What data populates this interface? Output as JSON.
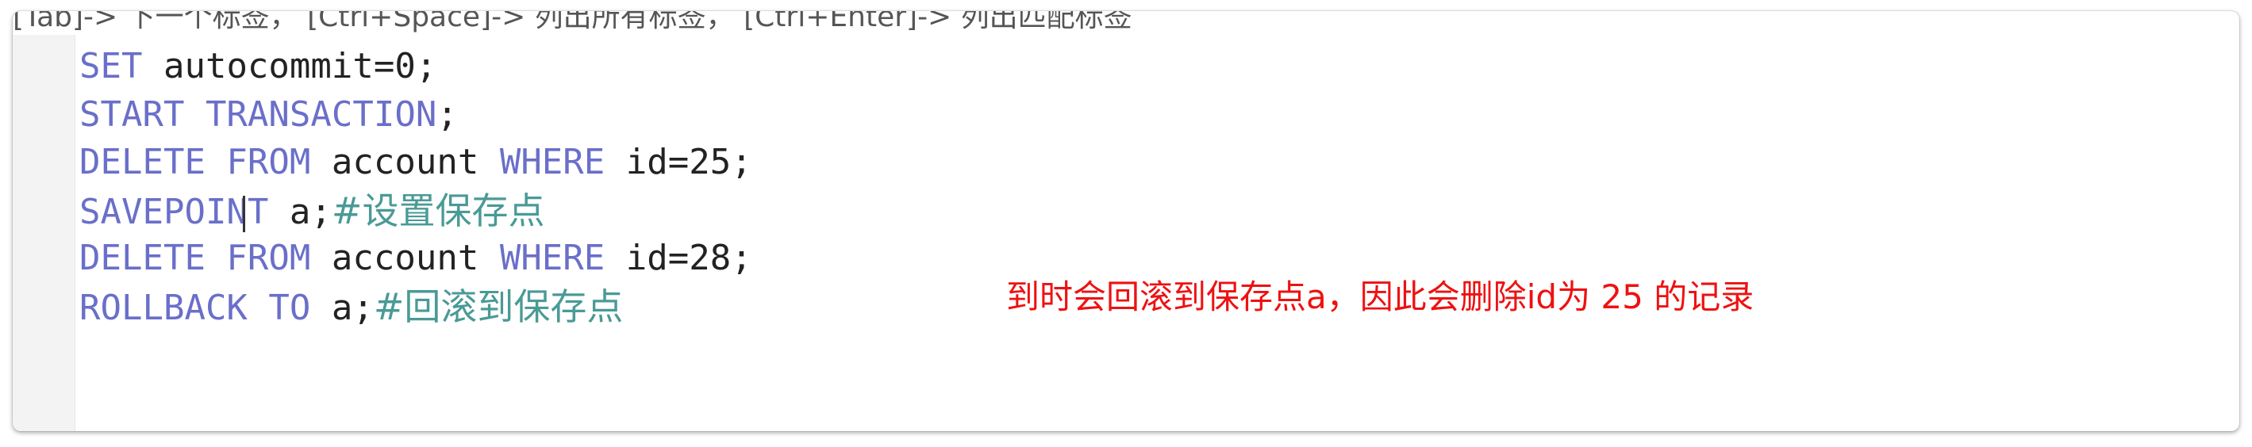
{
  "hint_bar": {
    "text": "[Tab]-> 下一个标签， [Ctrl+Space]-> 列出所有标签， [Ctrl+Enter]-> 列出匹配标签"
  },
  "editor": {
    "lines": [
      [
        {
          "text": "SET",
          "type": "keyword"
        },
        {
          "text": " autocommit=0;",
          "type": "plain"
        }
      ],
      [
        {
          "text": "START TRANSACTION",
          "type": "keyword"
        },
        {
          "text": ";",
          "type": "plain"
        }
      ],
      [
        {
          "text": "DELETE FROM",
          "type": "keyword"
        },
        {
          "text": " account ",
          "type": "plain"
        },
        {
          "text": "WHERE",
          "type": "keyword"
        },
        {
          "text": " id=25;",
          "type": "plain"
        }
      ],
      [
        {
          "text": "SAVEPOINT",
          "type": "keyword"
        },
        {
          "text": " a;",
          "type": "plain"
        },
        {
          "text": "#设置保存点",
          "type": "comment"
        }
      ],
      [
        {
          "text": "DELETE FROM",
          "type": "keyword"
        },
        {
          "text": " account ",
          "type": "plain"
        },
        {
          "text": "WHERE",
          "type": "keyword"
        },
        {
          "text": " id=28;",
          "type": "plain"
        }
      ],
      [
        {
          "text": "ROLLBACK TO",
          "type": "keyword"
        },
        {
          "text": " a;",
          "type": "plain"
        },
        {
          "text": "#回滚到保存点",
          "type": "comment"
        }
      ]
    ]
  },
  "annotation": {
    "text": "到时会回滚到保存点a，因此会删除id为 25 的记录"
  },
  "colors": {
    "keyword": "#6a6fc9",
    "plain": "#222222",
    "comment": "#4a9a96",
    "annotation": "#ee1111",
    "gutter": "#f3f3f3"
  }
}
